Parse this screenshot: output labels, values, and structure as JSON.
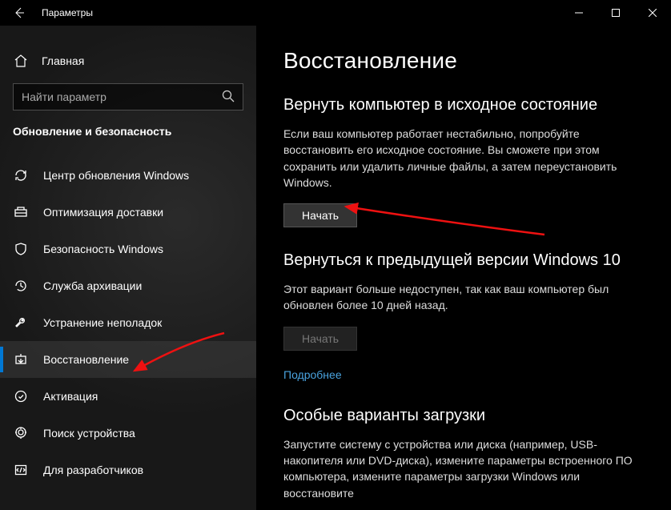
{
  "window": {
    "title": "Параметры"
  },
  "sidebar": {
    "home": "Главная",
    "search_placeholder": "Найти параметр",
    "section": "Обновление и безопасность",
    "items": [
      {
        "label": "Центр обновления Windows"
      },
      {
        "label": "Оптимизация доставки"
      },
      {
        "label": "Безопасность Windows"
      },
      {
        "label": "Служба архивации"
      },
      {
        "label": "Устранение неполадок"
      },
      {
        "label": "Восстановление"
      },
      {
        "label": "Активация"
      },
      {
        "label": "Поиск устройства"
      },
      {
        "label": "Для разработчиков"
      }
    ]
  },
  "content": {
    "title": "Восстановление",
    "reset": {
      "heading": "Вернуть компьютер в исходное состояние",
      "desc": "Если ваш компьютер работает нестабильно, попробуйте восстановить его исходное состояние. Вы сможете при этом сохранить или удалить личные файлы, а затем переустановить Windows.",
      "button": "Начать"
    },
    "rollback": {
      "heading": "Вернуться к предыдущей версии Windows 10",
      "desc": "Этот вариант больше недоступен, так как ваш компьютер был обновлен более 10 дней назад.",
      "button": "Начать",
      "link": "Подробнее"
    },
    "advanced": {
      "heading": "Особые варианты загрузки",
      "desc": "Запустите систему с устройства или диска (например, USB-накопителя или DVD-диска), измените параметры встроенного ПО компьютера, измените параметры загрузки Windows или восстановите"
    }
  }
}
